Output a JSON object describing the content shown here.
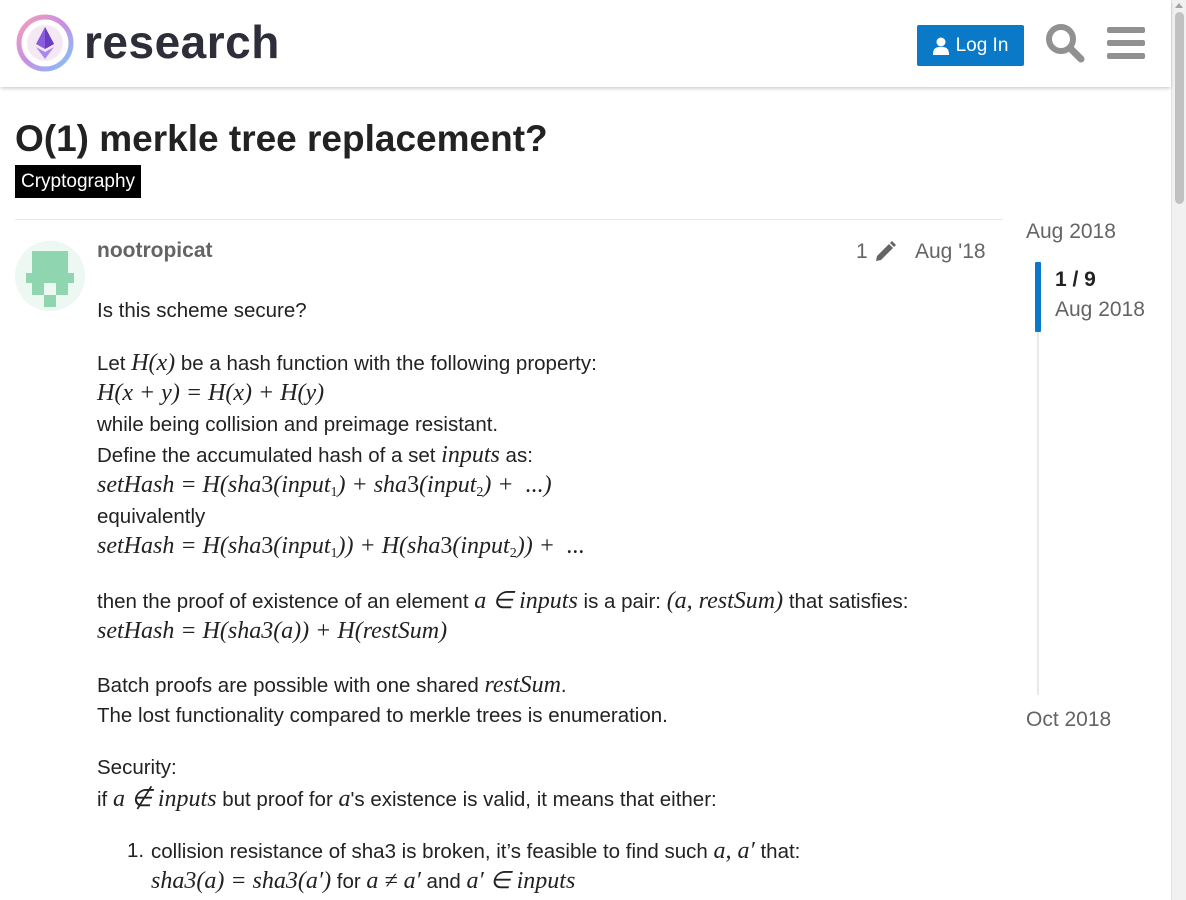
{
  "header": {
    "brand": "research",
    "login_label": "Log In"
  },
  "topic": {
    "title": "O(1) merkle tree replacement?",
    "category": "Cryptography"
  },
  "post": {
    "username": "nootropicat",
    "edit_count": "1",
    "date": "Aug '18",
    "lines": {
      "l1": "Is this scheme secure?",
      "l2_a": "Let ",
      "l2_b": " be a hash function with the following property:",
      "l4": "while being collision and preimage resistant.",
      "l5_a": "Define the accumulated hash of a set ",
      "l5_b": " as:",
      "l7": "equivalently",
      "l9_a": "then the proof of existence of an element ",
      "l9_b": " is a pair: ",
      "l9_c": " that satisfies:",
      "l11_a": "Batch proofs are possible with one shared ",
      "l11_b": ".",
      "l12": "The lost functionality compared to merkle trees is enumeration.",
      "l13": "Security:",
      "l14_a": "if ",
      "l14_b": " but proof for ",
      "l14_c": "'s existence is valid, it means that either:",
      "li1_num": "1.",
      "li1_a": "collision resistance of sha3 is broken, it’s feasible to find such ",
      "li1_b": " that:",
      "li1_c": " for ",
      "li1_d": " and "
    },
    "math": {
      "Hx": "H(x)",
      "prop": "H(x + y) = H(x) + H(y)",
      "inputs": "inputs",
      "setHash": "setHash",
      "a": "a",
      "a_in_inputs": "a ∈ inputs",
      "pair": "(a, restSum)",
      "proof_eq": "setHash = H(sha3(a)) + H(restSum)",
      "restSum": "restSum",
      "a_notin": "a ∉ inputs",
      "a_ap": "a, a′",
      "sha_eq": "sha3(a) = sha3(a′)",
      "a_neq": "a ≠ a′",
      "ap_in": "a′ ∈ inputs"
    }
  },
  "timeline": {
    "top_date": "Aug 2018",
    "position": "1 / 9",
    "position_date": "Aug 2018",
    "bottom_date": "Oct 2018"
  }
}
